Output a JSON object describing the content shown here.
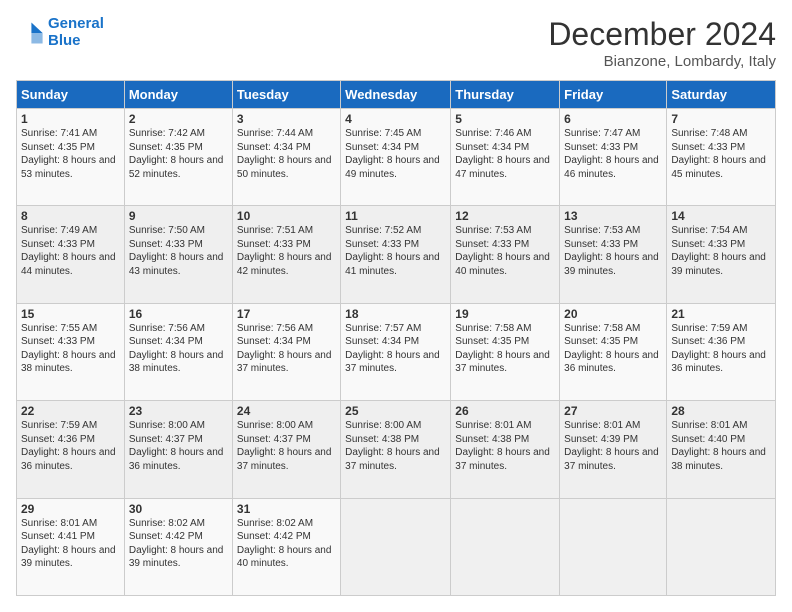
{
  "logo": {
    "line1": "General",
    "line2": "Blue"
  },
  "title": "December 2024",
  "location": "Bianzone, Lombardy, Italy",
  "days_of_week": [
    "Sunday",
    "Monday",
    "Tuesday",
    "Wednesday",
    "Thursday",
    "Friday",
    "Saturday"
  ],
  "weeks": [
    [
      {
        "day": "1",
        "sunrise": "Sunrise: 7:41 AM",
        "sunset": "Sunset: 4:35 PM",
        "daylight": "Daylight: 8 hours and 53 minutes."
      },
      {
        "day": "2",
        "sunrise": "Sunrise: 7:42 AM",
        "sunset": "Sunset: 4:35 PM",
        "daylight": "Daylight: 8 hours and 52 minutes."
      },
      {
        "day": "3",
        "sunrise": "Sunrise: 7:44 AM",
        "sunset": "Sunset: 4:34 PM",
        "daylight": "Daylight: 8 hours and 50 minutes."
      },
      {
        "day": "4",
        "sunrise": "Sunrise: 7:45 AM",
        "sunset": "Sunset: 4:34 PM",
        "daylight": "Daylight: 8 hours and 49 minutes."
      },
      {
        "day": "5",
        "sunrise": "Sunrise: 7:46 AM",
        "sunset": "Sunset: 4:34 PM",
        "daylight": "Daylight: 8 hours and 47 minutes."
      },
      {
        "day": "6",
        "sunrise": "Sunrise: 7:47 AM",
        "sunset": "Sunset: 4:33 PM",
        "daylight": "Daylight: 8 hours and 46 minutes."
      },
      {
        "day": "7",
        "sunrise": "Sunrise: 7:48 AM",
        "sunset": "Sunset: 4:33 PM",
        "daylight": "Daylight: 8 hours and 45 minutes."
      }
    ],
    [
      {
        "day": "8",
        "sunrise": "Sunrise: 7:49 AM",
        "sunset": "Sunset: 4:33 PM",
        "daylight": "Daylight: 8 hours and 44 minutes."
      },
      {
        "day": "9",
        "sunrise": "Sunrise: 7:50 AM",
        "sunset": "Sunset: 4:33 PM",
        "daylight": "Daylight: 8 hours and 43 minutes."
      },
      {
        "day": "10",
        "sunrise": "Sunrise: 7:51 AM",
        "sunset": "Sunset: 4:33 PM",
        "daylight": "Daylight: 8 hours and 42 minutes."
      },
      {
        "day": "11",
        "sunrise": "Sunrise: 7:52 AM",
        "sunset": "Sunset: 4:33 PM",
        "daylight": "Daylight: 8 hours and 41 minutes."
      },
      {
        "day": "12",
        "sunrise": "Sunrise: 7:53 AM",
        "sunset": "Sunset: 4:33 PM",
        "daylight": "Daylight: 8 hours and 40 minutes."
      },
      {
        "day": "13",
        "sunrise": "Sunrise: 7:53 AM",
        "sunset": "Sunset: 4:33 PM",
        "daylight": "Daylight: 8 hours and 39 minutes."
      },
      {
        "day": "14",
        "sunrise": "Sunrise: 7:54 AM",
        "sunset": "Sunset: 4:33 PM",
        "daylight": "Daylight: 8 hours and 39 minutes."
      }
    ],
    [
      {
        "day": "15",
        "sunrise": "Sunrise: 7:55 AM",
        "sunset": "Sunset: 4:33 PM",
        "daylight": "Daylight: 8 hours and 38 minutes."
      },
      {
        "day": "16",
        "sunrise": "Sunrise: 7:56 AM",
        "sunset": "Sunset: 4:34 PM",
        "daylight": "Daylight: 8 hours and 38 minutes."
      },
      {
        "day": "17",
        "sunrise": "Sunrise: 7:56 AM",
        "sunset": "Sunset: 4:34 PM",
        "daylight": "Daylight: 8 hours and 37 minutes."
      },
      {
        "day": "18",
        "sunrise": "Sunrise: 7:57 AM",
        "sunset": "Sunset: 4:34 PM",
        "daylight": "Daylight: 8 hours and 37 minutes."
      },
      {
        "day": "19",
        "sunrise": "Sunrise: 7:58 AM",
        "sunset": "Sunset: 4:35 PM",
        "daylight": "Daylight: 8 hours and 37 minutes."
      },
      {
        "day": "20",
        "sunrise": "Sunrise: 7:58 AM",
        "sunset": "Sunset: 4:35 PM",
        "daylight": "Daylight: 8 hours and 36 minutes."
      },
      {
        "day": "21",
        "sunrise": "Sunrise: 7:59 AM",
        "sunset": "Sunset: 4:36 PM",
        "daylight": "Daylight: 8 hours and 36 minutes."
      }
    ],
    [
      {
        "day": "22",
        "sunrise": "Sunrise: 7:59 AM",
        "sunset": "Sunset: 4:36 PM",
        "daylight": "Daylight: 8 hours and 36 minutes."
      },
      {
        "day": "23",
        "sunrise": "Sunrise: 8:00 AM",
        "sunset": "Sunset: 4:37 PM",
        "daylight": "Daylight: 8 hours and 36 minutes."
      },
      {
        "day": "24",
        "sunrise": "Sunrise: 8:00 AM",
        "sunset": "Sunset: 4:37 PM",
        "daylight": "Daylight: 8 hours and 37 minutes."
      },
      {
        "day": "25",
        "sunrise": "Sunrise: 8:00 AM",
        "sunset": "Sunset: 4:38 PM",
        "daylight": "Daylight: 8 hours and 37 minutes."
      },
      {
        "day": "26",
        "sunrise": "Sunrise: 8:01 AM",
        "sunset": "Sunset: 4:38 PM",
        "daylight": "Daylight: 8 hours and 37 minutes."
      },
      {
        "day": "27",
        "sunrise": "Sunrise: 8:01 AM",
        "sunset": "Sunset: 4:39 PM",
        "daylight": "Daylight: 8 hours and 37 minutes."
      },
      {
        "day": "28",
        "sunrise": "Sunrise: 8:01 AM",
        "sunset": "Sunset: 4:40 PM",
        "daylight": "Daylight: 8 hours and 38 minutes."
      }
    ],
    [
      {
        "day": "29",
        "sunrise": "Sunrise: 8:01 AM",
        "sunset": "Sunset: 4:41 PM",
        "daylight": "Daylight: 8 hours and 39 minutes."
      },
      {
        "day": "30",
        "sunrise": "Sunrise: 8:02 AM",
        "sunset": "Sunset: 4:42 PM",
        "daylight": "Daylight: 8 hours and 39 minutes."
      },
      {
        "day": "31",
        "sunrise": "Sunrise: 8:02 AM",
        "sunset": "Sunset: 4:42 PM",
        "daylight": "Daylight: 8 hours and 40 minutes."
      },
      null,
      null,
      null,
      null
    ]
  ]
}
